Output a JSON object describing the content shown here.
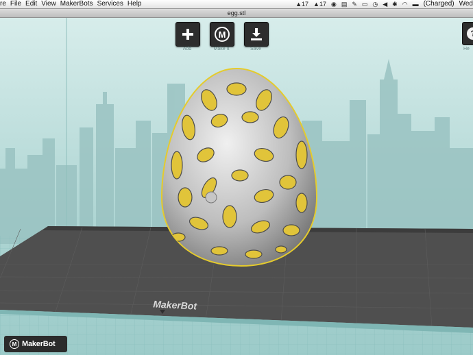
{
  "menubar": {
    "items": [
      "re",
      "File",
      "Edit",
      "View",
      "MakerBots",
      "Services",
      "Help"
    ],
    "status": {
      "adobe_left": "17",
      "adobe_right": "17",
      "battery_text": "(Charged)",
      "clock": "Wed"
    }
  },
  "window": {
    "title": "egg.stl"
  },
  "toolbar": {
    "add_label": "Add",
    "make_label": "Make It",
    "save_label": "Save",
    "help_label": "He"
  },
  "platform": {
    "brand": "MakerBot"
  },
  "footer": {
    "logo_text": "MakerBot"
  },
  "colors": {
    "sky_top": "#d6ecea",
    "sky_bottom": "#a7d2d0",
    "platform": "#505050",
    "grid_floor": "#9fcfcd",
    "model": "#8b8b8b",
    "model_highlight": "#e5cb2c"
  }
}
